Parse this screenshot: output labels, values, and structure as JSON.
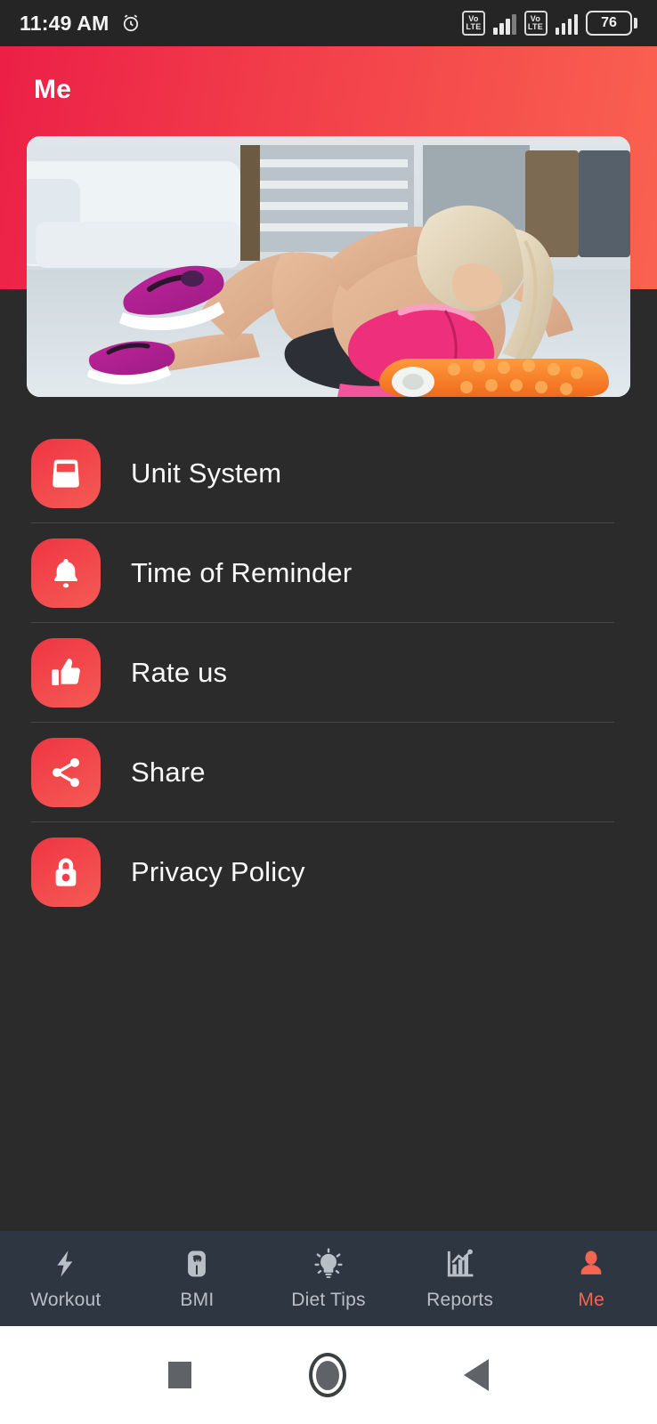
{
  "status_bar": {
    "time": "11:49 AM",
    "alarm_icon": "alarm-clock-icon",
    "sim1_network": "VoLTE",
    "sim1_network_line1": "Vo",
    "sim1_network_line2": "LTE",
    "sim2_network_line1": "Vo",
    "sim2_network_line2": "LTE",
    "battery_percent": "76"
  },
  "header": {
    "title": "Me",
    "gradient_start": "#ec1f47",
    "gradient_end": "#fa6250"
  },
  "hero": {
    "alt": "woman doing crunches on floor with foam roller",
    "name": "hero-banner-image"
  },
  "menu": {
    "items": [
      {
        "label": "Unit System",
        "icon": "weight-scale-icon"
      },
      {
        "label": "Time of Reminder",
        "icon": "bell-icon"
      },
      {
        "label": "Rate us",
        "icon": "thumbs-up-icon"
      },
      {
        "label": "Share",
        "icon": "share-nodes-icon"
      },
      {
        "label": "Privacy Policy",
        "icon": "lock-icon"
      }
    ]
  },
  "bottom_nav": {
    "active_color": "#f4664f",
    "inactive_color": "#b9bfc7",
    "items": [
      {
        "label": "Workout",
        "icon": "lightning-bolt-icon",
        "active": false
      },
      {
        "label": "BMI",
        "icon": "body-scale-icon",
        "active": false
      },
      {
        "label": "Diet Tips",
        "icon": "lightbulb-icon",
        "active": false
      },
      {
        "label": "Reports",
        "icon": "bar-chart-icon",
        "active": false
      },
      {
        "label": "Me",
        "icon": "person-icon",
        "active": true
      }
    ]
  },
  "system_nav": {
    "recents": "square-recents-icon",
    "home": "circle-home-icon",
    "back": "triangle-back-icon"
  }
}
